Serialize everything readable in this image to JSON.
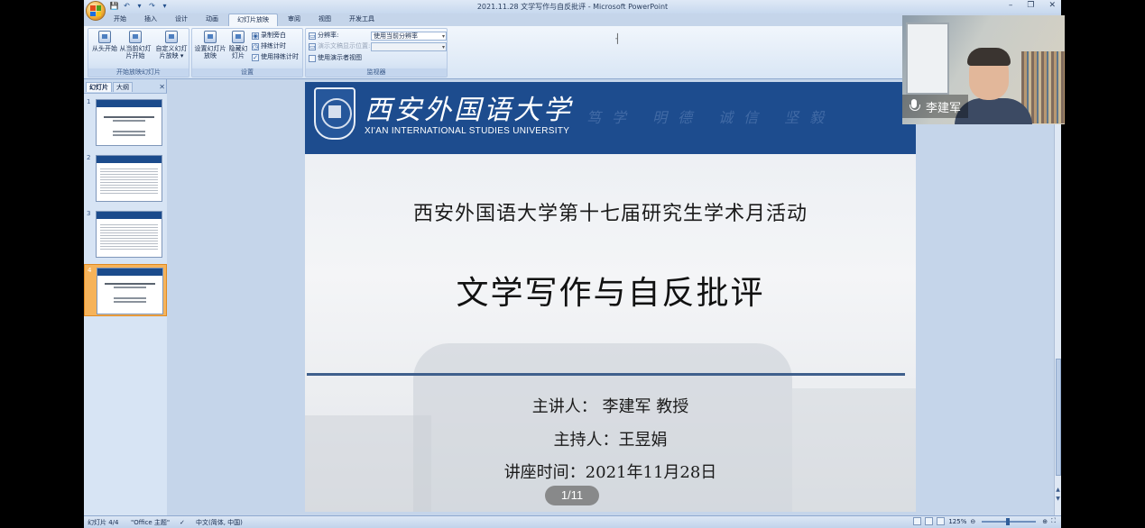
{
  "window": {
    "title": "2021.11.28 文学写作与自反批评 - Microsoft PowerPoint",
    "controls": [
      "–",
      "❐",
      "✕"
    ]
  },
  "qat": [
    "💾",
    "↶",
    "▾",
    "↷",
    "▾"
  ],
  "ribbon": {
    "tabs": [
      "开始",
      "插入",
      "设计",
      "动画",
      "幻灯片放映",
      "审阅",
      "视图",
      "开发工具"
    ],
    "active_tab": "幻灯片放映",
    "group_start": {
      "label": "开始放映幻灯片",
      "buttons": [
        "从头开始",
        "从当前幻灯片开始",
        "自定义幻灯片放映 ▾"
      ]
    },
    "group_setup": {
      "label": "设置",
      "buttons": [
        "设置幻灯片放映",
        "隐藏幻灯片"
      ],
      "small": [
        "录制旁白",
        "排练计时",
        "使用排练计时"
      ]
    },
    "group_monitors": {
      "label": "监视器",
      "resolution_label": "分辨率:",
      "resolution_value": "使用当前分辨率",
      "show_on_label": "演示文稿显示位置:",
      "presenter_view": "使用演示者视图"
    }
  },
  "left_pane": {
    "tab_slides": "幻灯片",
    "tab_outline": "大纲",
    "close": "✕",
    "slide_numbers": [
      "1",
      "2",
      "3",
      "4"
    ],
    "selected": "4"
  },
  "slide": {
    "uni_cn": "西安外国语大学",
    "uni_en": "XI'AN INTERNATIONAL STUDIES UNIVERSITY",
    "motto": "笃学 明德 诚信 坚毅",
    "event": "西安外国语大学第十七届研究生学术月活动",
    "title": "文学写作与自反批评",
    "speaker": "主讲人：  李建军  教授",
    "host": "主持人：王昱娟",
    "time": "讲座时间：2021年11月28日",
    "pager": "1/11"
  },
  "webcam": {
    "name": "李建军"
  },
  "status": {
    "slide_info": "幻灯片 4/4",
    "theme": "\"Office 主题\"",
    "language": "中文(简体, 中国)",
    "zoom": "125%"
  }
}
